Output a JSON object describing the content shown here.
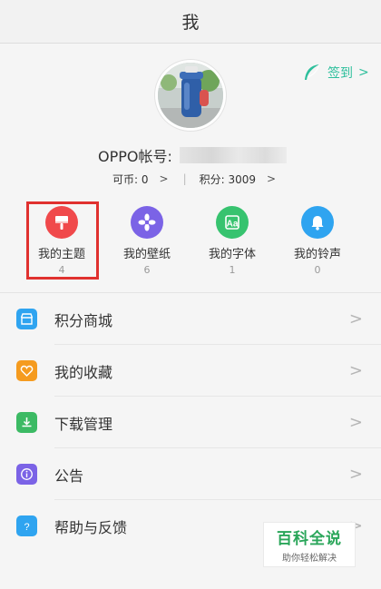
{
  "header": {
    "title": "我"
  },
  "profile": {
    "signin_label": "签到",
    "account_label": "OPPO帐号:",
    "coins_label": "可币: 0",
    "points_label": "积分: 3009"
  },
  "grid": [
    {
      "label": "我的主题",
      "count": "4",
      "icon": "paint-brush-icon",
      "color": "#f0494b"
    },
    {
      "label": "我的壁纸",
      "count": "6",
      "icon": "flower-icon",
      "color": "#7b63e6"
    },
    {
      "label": "我的字体",
      "count": "1",
      "icon": "font-icon",
      "color": "#37c36f"
    },
    {
      "label": "我的铃声",
      "count": "0",
      "icon": "bell-icon",
      "color": "#2fa4f0"
    }
  ],
  "list": [
    {
      "label": "积分商城",
      "icon": "shop-icon",
      "color": "#2fa4f0"
    },
    {
      "label": "我的收藏",
      "icon": "heart-icon",
      "color": "#f59b1f"
    },
    {
      "label": "下载管理",
      "icon": "download-icon",
      "color": "#3cba64"
    },
    {
      "label": "公告",
      "icon": "info-icon",
      "color": "#7b63e6"
    },
    {
      "label": "帮助与反馈",
      "icon": "help-icon",
      "color": "#2fa4f0"
    }
  ],
  "watermark": {
    "title": "百科全说",
    "subtitle": "助你轻松解决"
  }
}
